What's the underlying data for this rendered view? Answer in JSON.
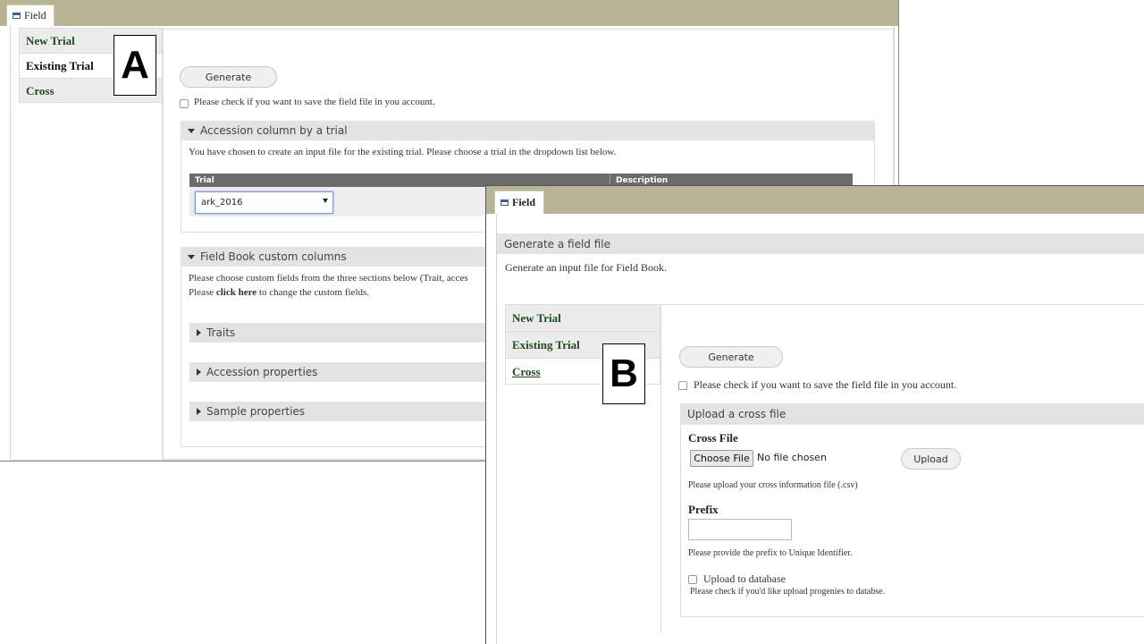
{
  "panel_a": {
    "tab_label": "Field",
    "callout": "A",
    "vtabs": [
      "New Trial",
      "Existing Trial",
      "Cross"
    ],
    "generate_label": "Generate",
    "save_check_label": "Please check if you want to save the field file in you account.",
    "accession_section": {
      "title": "Accession column by a trial",
      "description": "You have chosen to create an input file for the existing trial. Please choose a trial in the dropdown list below.",
      "col_trial": "Trial",
      "col_description": "Description",
      "selected_trial": "ark_2016"
    },
    "custom_section": {
      "title": "Field Book custom columns",
      "line1": "Please choose custom fields from the three sections below (Trait, acces",
      "line2_prefix": "Please ",
      "line2_link": "click here",
      "line2_suffix": " to change the custom fields.",
      "subsections": [
        "Traits",
        "Accession properties",
        "Sample properties"
      ]
    }
  },
  "panel_b": {
    "tab_label": "Field",
    "callout": "B",
    "header": "Generate a field file",
    "subheader": "Generate an input file for Field Book.",
    "vtabs": [
      "New Trial",
      "Existing Trial",
      "Cross"
    ],
    "generate_label": "Generate",
    "save_check_label": "Please check if you want to save the field file in you account.",
    "upload_section": {
      "title": "Upload a cross file",
      "cross_file_label": "Cross File",
      "choose_file_label": "Choose File",
      "no_file_text": "No file chosen",
      "upload_label": "Upload",
      "upload_help": "Please upload your cross information file (.csv)",
      "prefix_label": "Prefix",
      "prefix_value": "",
      "prefix_help": "Please provide the prefix to Unique Identifier.",
      "db_check_label": "Upload to database",
      "db_check_help": "Please check if you'd like upload progenies to databse."
    }
  }
}
